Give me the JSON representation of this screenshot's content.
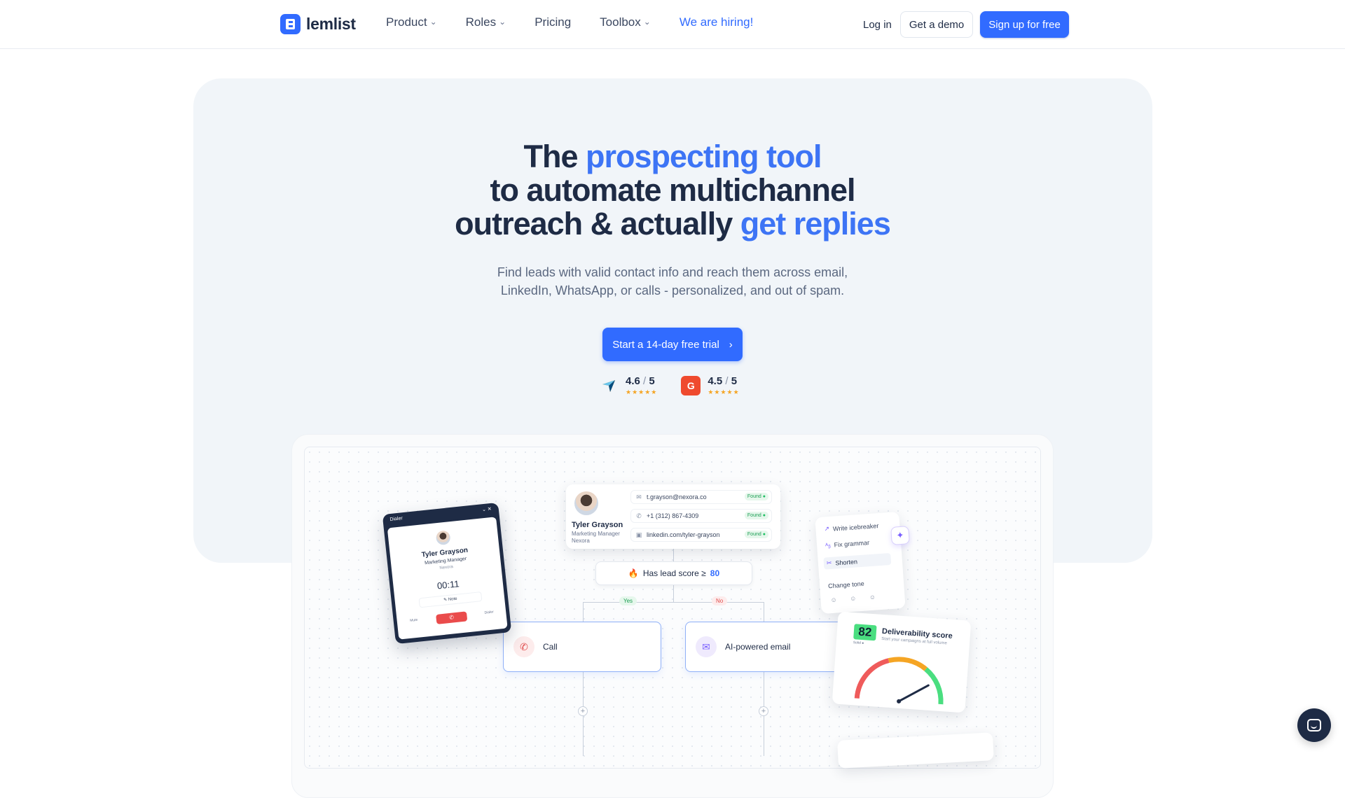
{
  "nav": {
    "logo_text": "lemlist",
    "links": [
      {
        "label": "Product",
        "dropdown": true
      },
      {
        "label": "Roles",
        "dropdown": true
      },
      {
        "label": "Pricing",
        "dropdown": false
      },
      {
        "label": "Toolbox",
        "dropdown": true
      },
      {
        "label": "We are hiring!",
        "dropdown": false
      }
    ],
    "chevron": "⌄",
    "login": "Log in",
    "demo": "Get a demo",
    "signup": "Sign up for free"
  },
  "hero": {
    "headline": {
      "l1_a": "The ",
      "l1_accent": "prospecting tool",
      "l2": "to automate multichannel",
      "l3_a": "outreach & actually ",
      "l3_accent": "get replies"
    },
    "subtitle_l1": "Find leads with valid contact info and reach them across email,",
    "subtitle_l2": "LinkedIn, WhatsApp, or calls - personalized, and out of spam.",
    "cta": "Start a 14-day free trial",
    "cta_icon": "›",
    "ratings": [
      {
        "icon": "capterra-arrow-icon",
        "score": "4.6",
        "out_of": "5",
        "stars": "★★★★★"
      },
      {
        "icon": "g2-icon",
        "badge": "G",
        "score": "4.5",
        "out_of": "5",
        "stars": "★★★★★"
      }
    ],
    "slash": "/"
  },
  "preview": {
    "lead": {
      "name": "Tyler Grayson",
      "role": "Marketing Manager",
      "company": "Nexora",
      "contacts": [
        {
          "icon": "mail-icon",
          "glyph": "✉",
          "value": "t.grayson@nexora.co",
          "status": "Found"
        },
        {
          "icon": "phone-icon",
          "glyph": "✆",
          "value": "+1 (312) 867-4309",
          "status": "Found"
        },
        {
          "icon": "linkedin-icon",
          "glyph": "▣",
          "value": "linkedin.com/tyler-grayson",
          "status": "Found"
        }
      ]
    },
    "condition": {
      "icon": "🔥",
      "text": "Has lead score ≥",
      "value": "80"
    },
    "branches": {
      "yes": "Yes",
      "no": "No"
    },
    "steps": [
      {
        "icon": "phone-icon",
        "glyph": "✆",
        "label": "Call"
      },
      {
        "icon": "mail-ai-icon",
        "glyph": "✉",
        "label": "AI-powered email"
      }
    ],
    "plus": "+",
    "dialer": {
      "title": "Dialer",
      "controls": "⌄ ✕",
      "name": "Tyler Grayson",
      "role": "Marketing Manager",
      "company": "Nexora",
      "time": "00:11",
      "note": "✎ Note",
      "end": "✆",
      "mute": "Mute",
      "dial": "Dialer"
    },
    "ai_menu": {
      "items": [
        {
          "glyph": "↗",
          "label": "Write icebreaker"
        },
        {
          "glyph": "ᴬᵦ",
          "label": "Fix grammar"
        },
        {
          "glyph": "✂",
          "label": "Shorten"
        },
        {
          "glyph": "",
          "label": "Change tone"
        }
      ],
      "emojis": "☺ ☺ ☺",
      "spark": "✦"
    },
    "deliverability": {
      "score": "82",
      "tag": "Solid ●",
      "title": "Deliverability score",
      "subtitle": "Start your campaigns at full volume",
      "value": 82,
      "max": 100,
      "colors": {
        "low": "#ef5b5b",
        "mid": "#f5a524",
        "high": "#4ade80"
      }
    }
  },
  "colors": {
    "brand": "#316bff",
    "accent_text": "#3d74f5",
    "ink": "#1e2b45"
  }
}
